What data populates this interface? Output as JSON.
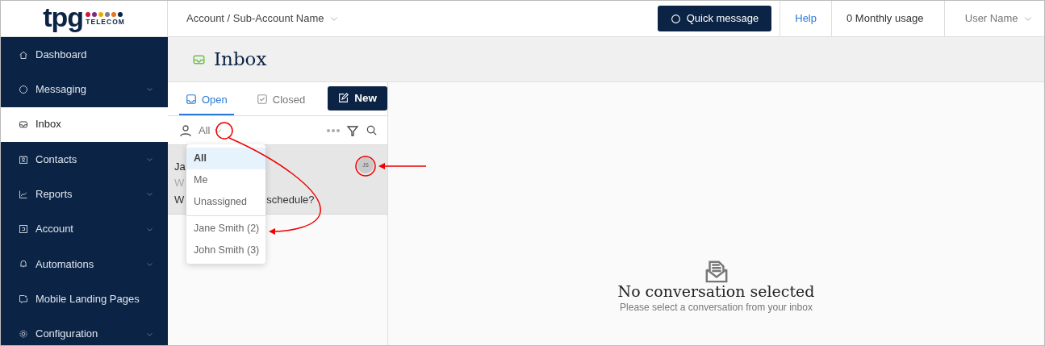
{
  "logo": {
    "wordmark": "tpg",
    "subtitle": "TELECOM",
    "dots": [
      {
        "color": "#d4163c"
      },
      {
        "color": "#7b2a85"
      },
      {
        "color": "#f0ab00"
      },
      {
        "color": "#7d7d8a"
      },
      {
        "color": "#e8741f"
      },
      {
        "color": "#0b2344"
      }
    ]
  },
  "header": {
    "account": "Account / Sub-Account Name",
    "quick_message": "Quick message",
    "help": "Help",
    "usage": "0 Monthly usage",
    "user": "User Name"
  },
  "sidebar": {
    "items": [
      {
        "label": "Dashboard",
        "expandable": false,
        "selected": false
      },
      {
        "label": "Messaging",
        "expandable": true,
        "selected": false
      },
      {
        "label": "Inbox",
        "expandable": false,
        "selected": true
      },
      {
        "label": "Contacts",
        "expandable": true,
        "selected": false
      },
      {
        "label": "Reports",
        "expandable": true,
        "selected": false
      },
      {
        "label": "Account",
        "expandable": true,
        "selected": false
      },
      {
        "label": "Automations",
        "expandable": true,
        "selected": false
      },
      {
        "label": "Mobile Landing Pages",
        "expandable": false,
        "selected": false
      },
      {
        "label": "Configuration",
        "expandable": true,
        "selected": false
      }
    ]
  },
  "page_title": "Inbox",
  "tabs": [
    {
      "label": "Open",
      "selected": true
    },
    {
      "label": "Closed",
      "selected": false
    }
  ],
  "new_button": "New",
  "filter": {
    "value": "All"
  },
  "conversation": {
    "name": "Ja",
    "subject": "W",
    "message_start": "W",
    "message_end": "schedule?",
    "avatar": "JS",
    "selected": true
  },
  "dropdown": {
    "items": [
      {
        "label": "All",
        "selected": true,
        "divider_before": false
      },
      {
        "label": "Me",
        "selected": false,
        "divider_before": false
      },
      {
        "label": "Unassigned",
        "selected": false,
        "divider_before": false
      },
      {
        "label": "Jane Smith (2)",
        "selected": false,
        "divider_before": true
      },
      {
        "label": "John Smith (3)",
        "selected": false,
        "divider_before": false
      }
    ]
  },
  "empty_state": {
    "title": "No conversation selected",
    "subtitle": "Please select a conversation from your inbox"
  }
}
